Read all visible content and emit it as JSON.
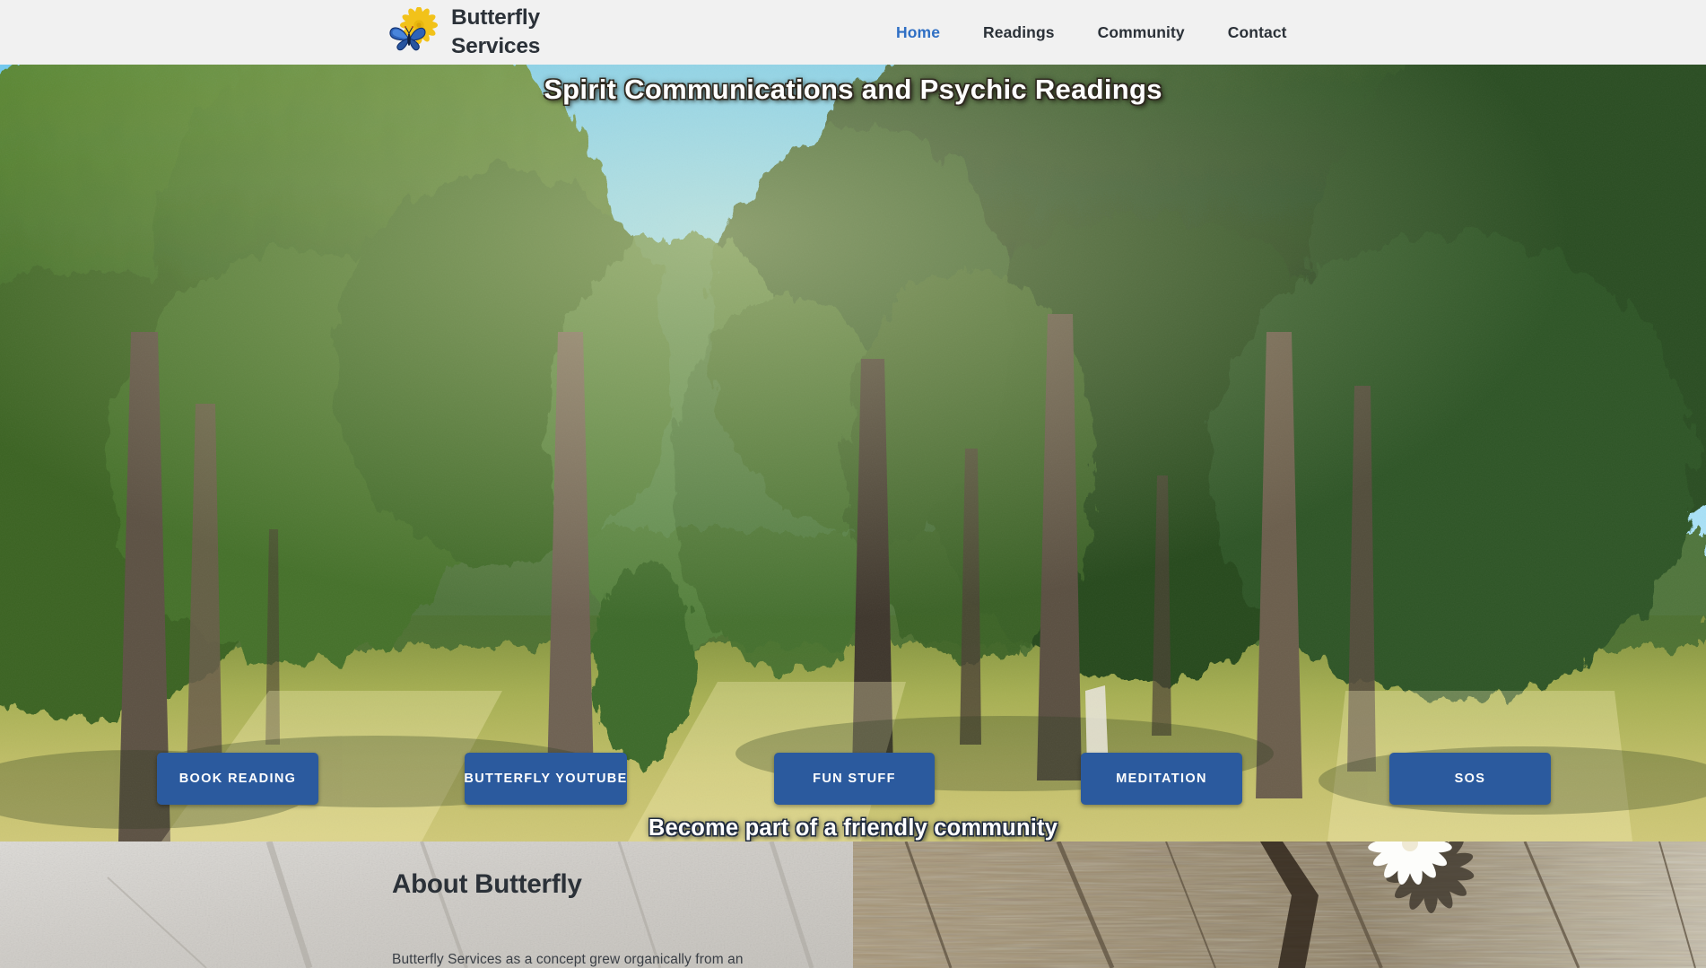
{
  "header": {
    "brand": {
      "name": "Butterfly\nServices",
      "logo_icon": "butterfly-on-yellow-flower-logo"
    },
    "nav": [
      {
        "label": "Home",
        "active": true
      },
      {
        "label": "Readings",
        "active": false
      },
      {
        "label": "Community",
        "active": false
      },
      {
        "label": "Contact",
        "active": false
      }
    ],
    "background_color": "#f1f1f1",
    "text_color": "#2b3138",
    "active_link_color": "#2f6fc4"
  },
  "hero": {
    "title": "Spirit Communications and Psychic Readings",
    "tagline": "Become part of a friendly community",
    "image_description": "sunlit forest clearing with tall conifer and willow trees, blue sky, grass",
    "buttons": [
      {
        "label": "BOOK READING"
      },
      {
        "label": "BUTTERFLY YOUTUBE"
      },
      {
        "label": "FUN STUFF"
      },
      {
        "label": "MEDITATION"
      },
      {
        "label": "SOS"
      }
    ],
    "button_color": "#2b5a9e",
    "button_text_color": "#ffffff",
    "title_color": "#ffffff"
  },
  "about": {
    "title": "About Butterfly",
    "body": "Butterfly Services as a concept grew organically from an",
    "left_texture": "pale-weathered-concrete",
    "right_texture": "cracked-wood-grain-with-white-daisy",
    "title_color": "#2b3138",
    "body_color": "#3a3f46"
  }
}
